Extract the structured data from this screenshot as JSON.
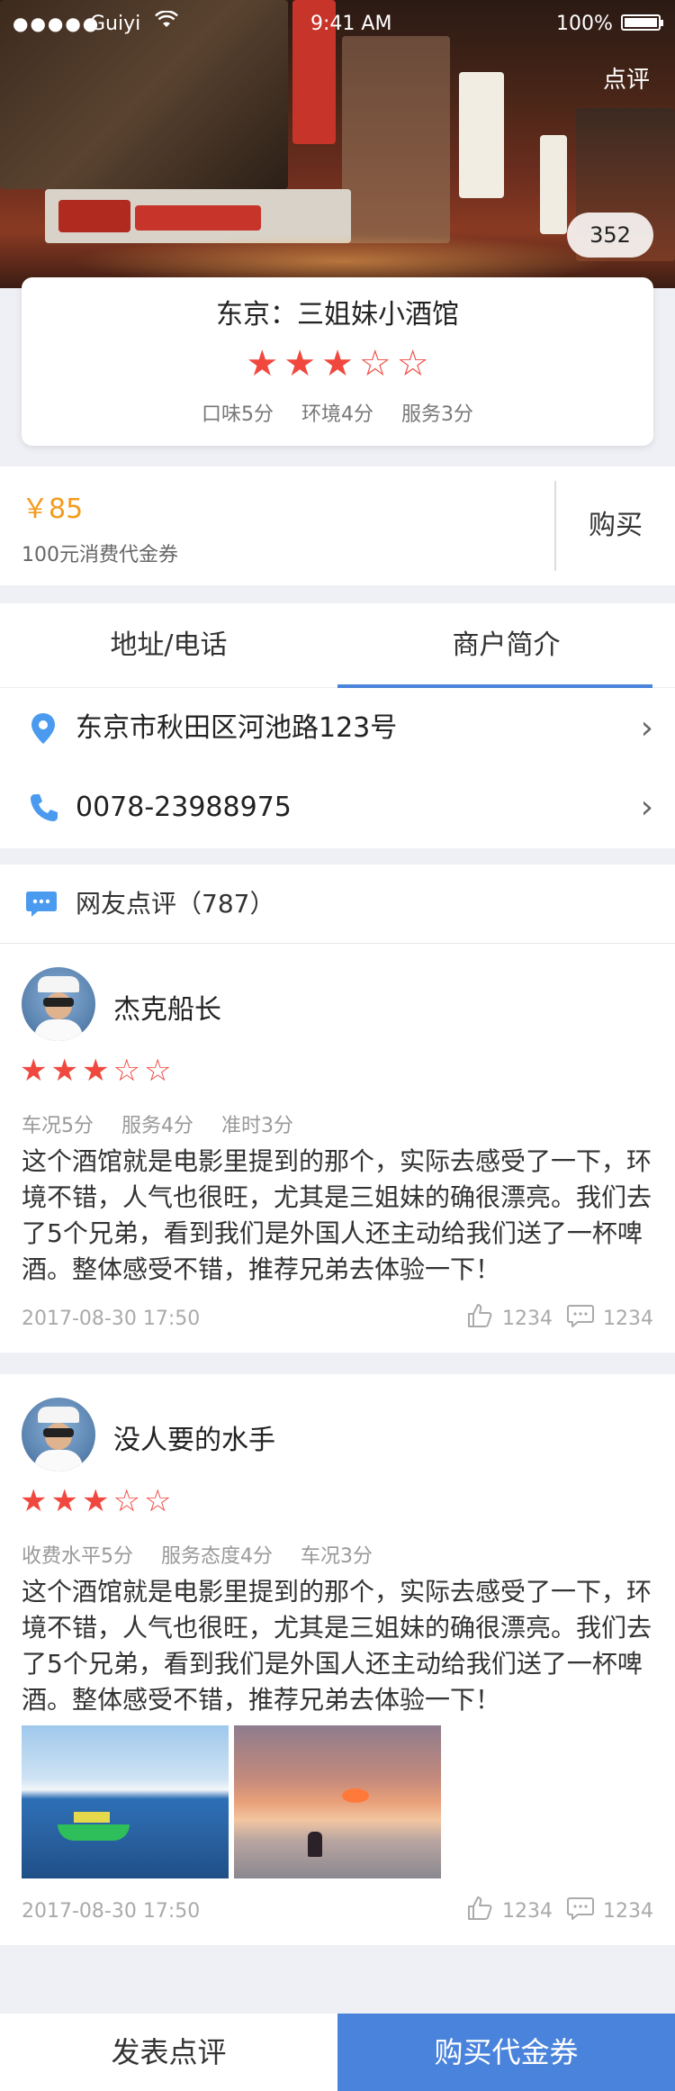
{
  "status_bar": {
    "signal": "●●●●●",
    "carrier": "Guiyi",
    "time": "9:41 AM",
    "battery": "100%"
  },
  "hero": {
    "review_link": "点评",
    "photo_count": "352"
  },
  "shop": {
    "title": "东京：三姐妹小酒馆",
    "rating": 3,
    "rating_max": 5,
    "scores": [
      "口味5分",
      "环境4分",
      "服务3分"
    ]
  },
  "voucher": {
    "price": "￥85",
    "description": "100元消费代金券",
    "buy_label": "购买"
  },
  "tabs": [
    "地址/电话",
    "商户简介"
  ],
  "contact": {
    "address": "东京市秋田区河池路123号",
    "phone": "0078-23988975"
  },
  "reviews_header": "网友点评（787）",
  "reviews": [
    {
      "name": "杰克船长",
      "rating": 3,
      "scores": [
        "车况5分",
        "服务4分",
        "准时3分"
      ],
      "text": "这个酒馆就是电影里提到的那个，实际去感受了一下，环境不错，人气也很旺，尤其是三姐妹的确很漂亮。我们去了5个兄弟，看到我们是外国人还主动给我们送了一杯啤酒。整体感受不错，推荐兄弟去体验一下！",
      "date": "2017-08-30   17:50",
      "likes": "1234",
      "comments": "1234"
    },
    {
      "name": "没人要的水手",
      "rating": 3,
      "scores": [
        "收费水平5分",
        "服务态度4分",
        "车况3分"
      ],
      "text": "这个酒馆就是电影里提到的那个，实际去感受了一下，环境不错，人气也很旺，尤其是三姐妹的确很漂亮。我们去了5个兄弟，看到我们是外国人还主动给我们送了一杯啤酒。整体感受不错，推荐兄弟去体验一下！",
      "date": "2017-08-30   17:50",
      "likes": "1234",
      "comments": "1234"
    }
  ],
  "bottom_bar": {
    "post_review": "发表点评",
    "buy_voucher": "购买代金券"
  },
  "colors": {
    "accent_blue": "#4a83db",
    "star_red": "#f0483e",
    "price_orange": "#f39c1f"
  }
}
